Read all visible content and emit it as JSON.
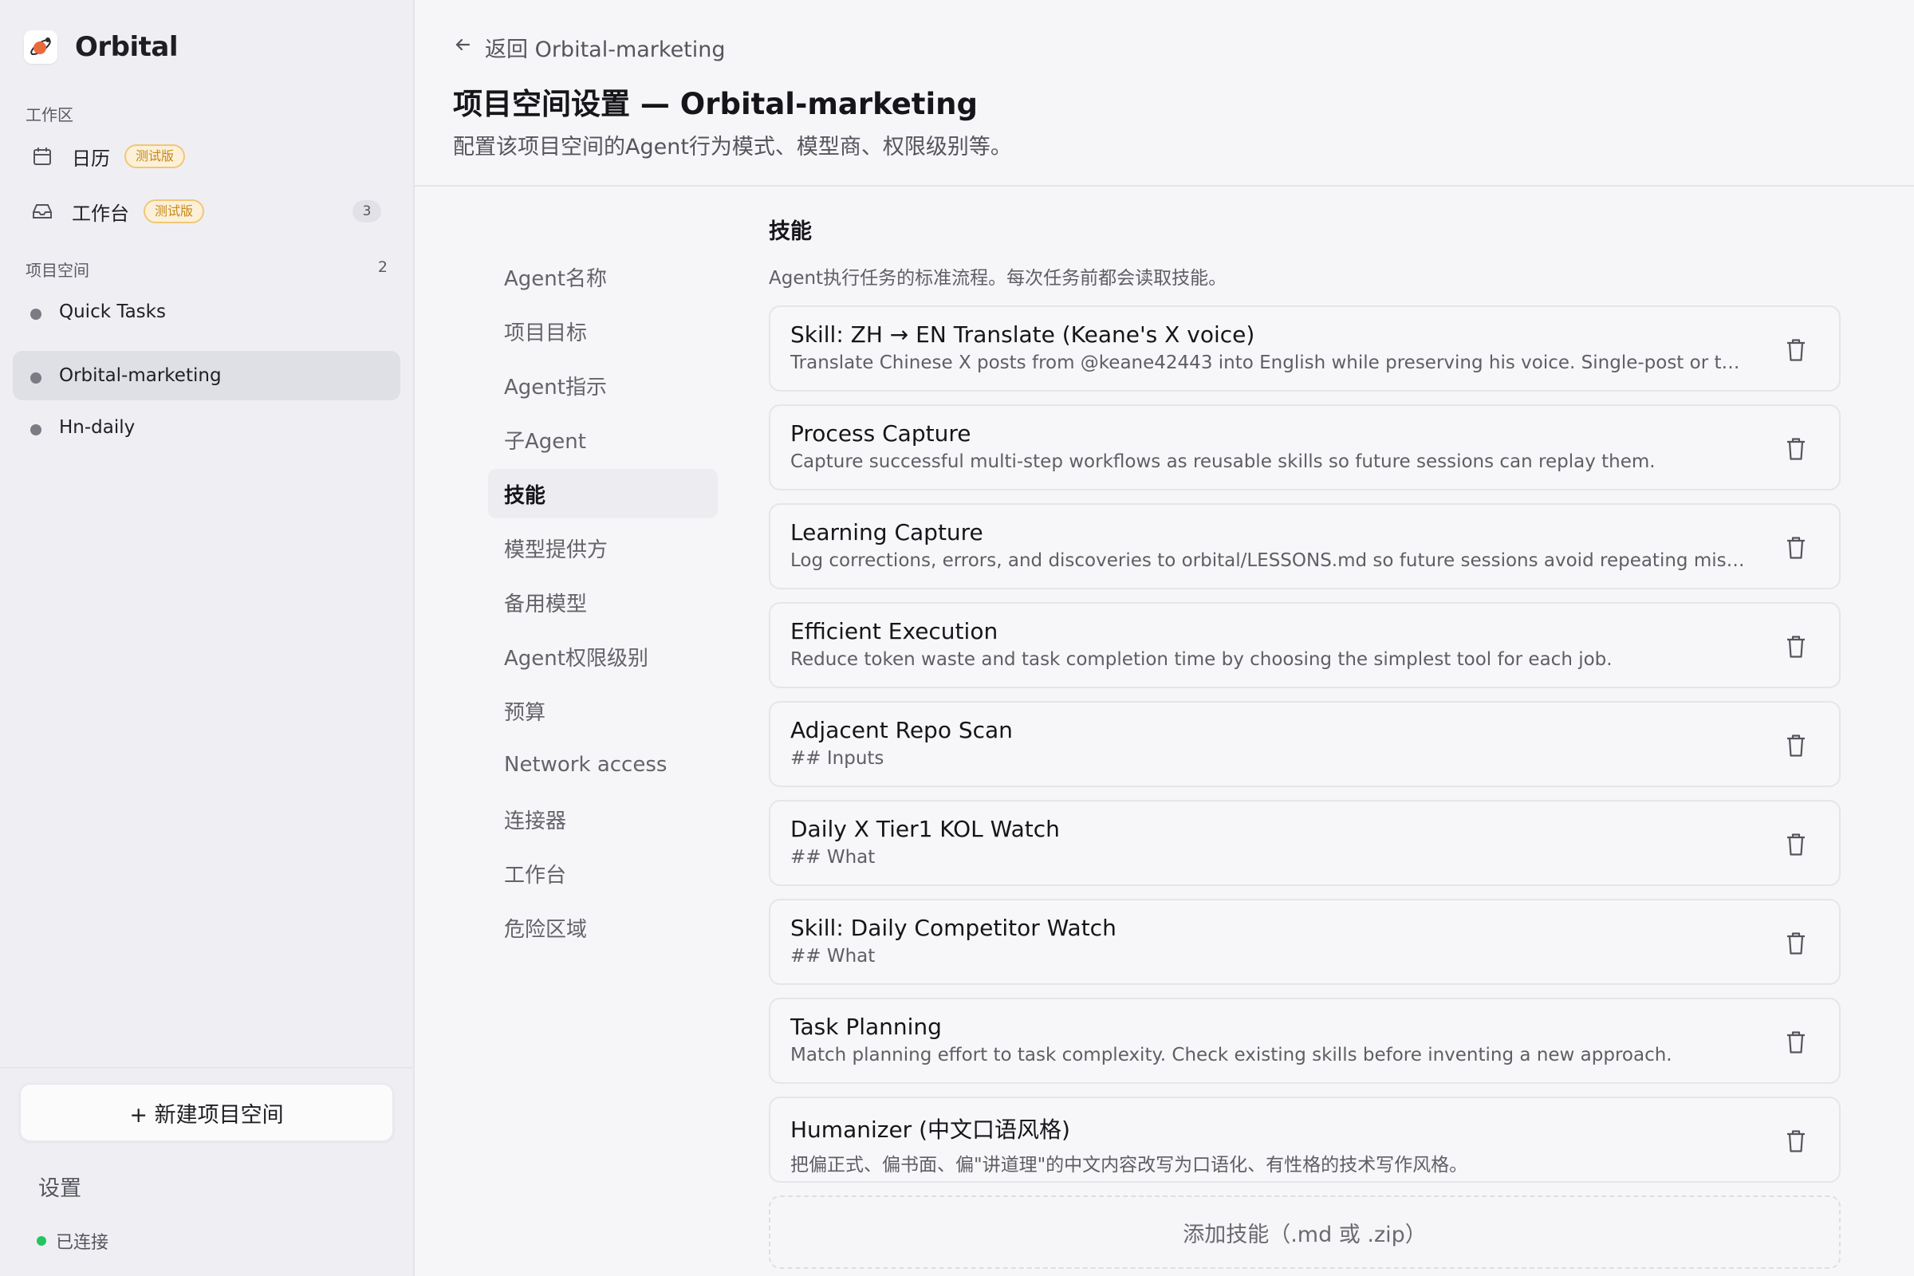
{
  "app": {
    "name": "Orbital"
  },
  "sidebar": {
    "workspace_label": "工作区",
    "workspace_items": [
      {
        "label": "日历",
        "badge": "测试版",
        "icon": "calendar-icon"
      },
      {
        "label": "工作台",
        "badge": "测试版",
        "count": "3",
        "icon": "inbox-icon"
      }
    ],
    "spaces_label": "项目空间",
    "spaces_count": "2",
    "spaces": [
      {
        "label": "Quick Tasks",
        "active": false
      },
      {
        "label": "Orbital-marketing",
        "active": true
      },
      {
        "label": "Hn-daily",
        "active": false
      }
    ],
    "new_space_label": "+ 新建项目空间",
    "settings_label": "设置",
    "connection_status": "已连接",
    "connection_color": "#22c55e"
  },
  "header": {
    "back_label": "返回 Orbital-marketing",
    "title": "项目空间设置 — Orbital-marketing",
    "subtitle": "配置该项目空间的Agent行为模式、模型商、权限级别等。"
  },
  "settings_nav": [
    {
      "label": "Agent名称",
      "active": false
    },
    {
      "label": "项目目标",
      "active": false
    },
    {
      "label": "Agent指示",
      "active": false
    },
    {
      "label": "子Agent",
      "active": false
    },
    {
      "label": "技能",
      "active": true
    },
    {
      "label": "模型提供方",
      "active": false
    },
    {
      "label": "备用模型",
      "active": false
    },
    {
      "label": "Agent权限级别",
      "active": false
    },
    {
      "label": "预算",
      "active": false
    },
    {
      "label": "Network access",
      "active": false
    },
    {
      "label": "连接器",
      "active": false
    },
    {
      "label": "工作台",
      "active": false
    },
    {
      "label": "危险区域",
      "active": false
    }
  ],
  "skills_section": {
    "title": "技能",
    "description": "Agent执行任务的标准流程。每次任务前都会读取技能。",
    "skills": [
      {
        "name": "Skill: ZH → EN Translate (Keane's X voice)",
        "description": "Translate Chinese X posts from @keane42443 into English while preserving his voice. Single-post or thread-l..."
      },
      {
        "name": "Process Capture",
        "description": "Capture successful multi-step workflows as reusable skills so future sessions can replay them."
      },
      {
        "name": "Learning Capture",
        "description": "Log corrections, errors, and discoveries to orbital/LESSONS.md so future sessions avoid repeating mistakes."
      },
      {
        "name": "Efficient Execution",
        "description": "Reduce token waste and task completion time by choosing the simplest tool for each job."
      },
      {
        "name": "Adjacent Repo Scan",
        "description": "## Inputs"
      },
      {
        "name": "Daily X Tier1 KOL Watch",
        "description": "## What"
      },
      {
        "name": "Skill: Daily Competitor Watch",
        "description": "## What"
      },
      {
        "name": "Task Planning",
        "description": "Match planning effort to task complexity. Check existing skills before inventing a new approach."
      },
      {
        "name": "Humanizer (中文口语风格)",
        "description": "把偏正式、偏书面、偏\"讲道理\"的中文内容改写为口语化、有性格的技术写作风格。"
      }
    ],
    "add_label": "添加技能（.md 或 .zip）"
  }
}
